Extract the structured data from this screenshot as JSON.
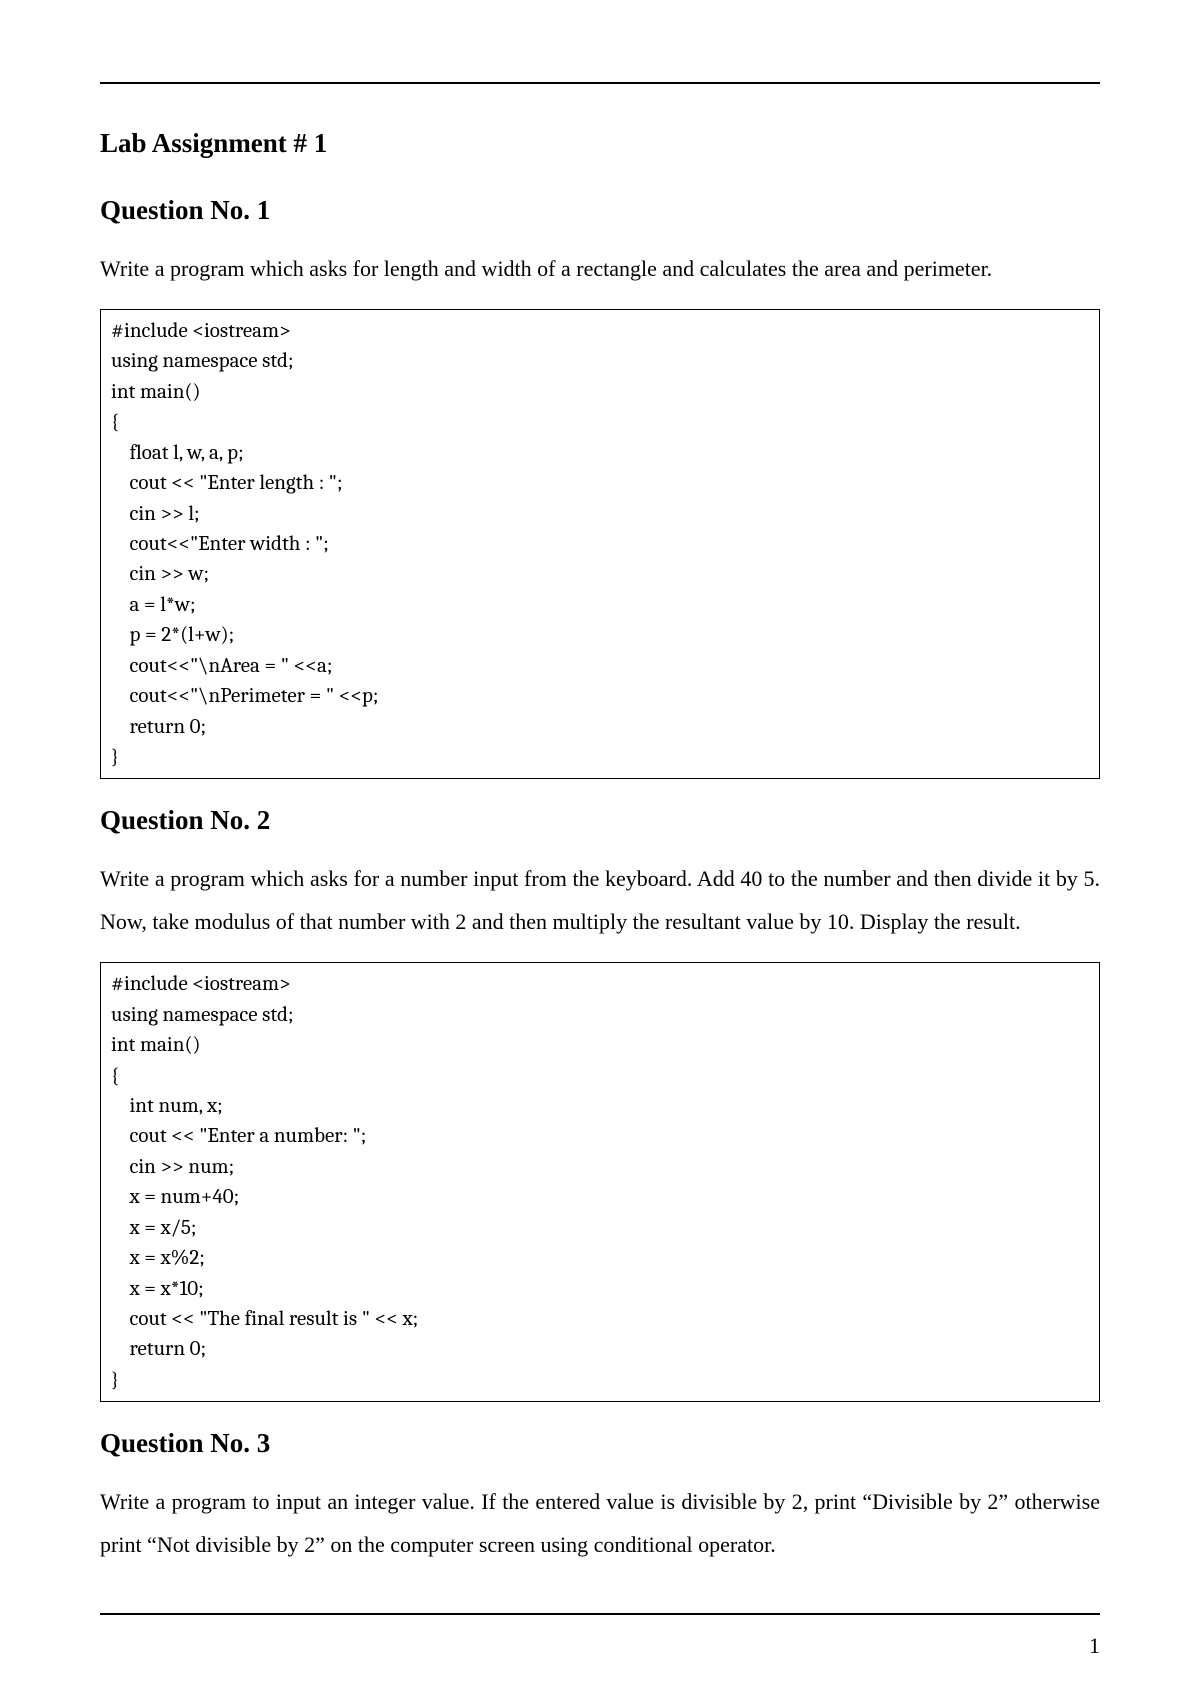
{
  "page": {
    "number": "1"
  },
  "assignment": {
    "title": "Lab Assignment # 1"
  },
  "questions": [
    {
      "heading": "Question No. 1",
      "text": "Write a program which asks for length and width of a rectangle and calculates the area and perimeter.",
      "code": "#include <iostream>\nusing namespace std;\nint main()\n{\n    float l, w, a, p;\n    cout << \"Enter length : \";\n    cin >> l;\n    cout<<\"Enter width : \";\n    cin >> w;\n    a = l*w;\n    p = 2*(l+w);\n    cout<<\"\\nArea = \" <<a;\n    cout<<\"\\nPerimeter = \" <<p;\n    return 0;\n}"
    },
    {
      "heading": "Question No. 2",
      "text": "Write a program which asks for a number input from the keyboard. Add 40 to the number and then divide it by 5. Now, take modulus of that number with 2 and then multiply the resultant value by 10. Display the result.",
      "code": "#include <iostream>\nusing namespace std;\nint main()\n{\n    int num, x;\n    cout << \"Enter a number: \";\n    cin >> num;\n    x = num+40;\n    x = x/5;\n    x = x%2;\n    x = x*10;\n    cout << \"The final result is \" << x;\n    return 0;\n}"
    },
    {
      "heading": "Question No. 3",
      "text": "Write a program to input an integer value. If the entered value is divisible by 2, print “Divisible by 2” otherwise print “Not divisible by 2” on the computer screen using conditional operator.",
      "code": null
    }
  ]
}
